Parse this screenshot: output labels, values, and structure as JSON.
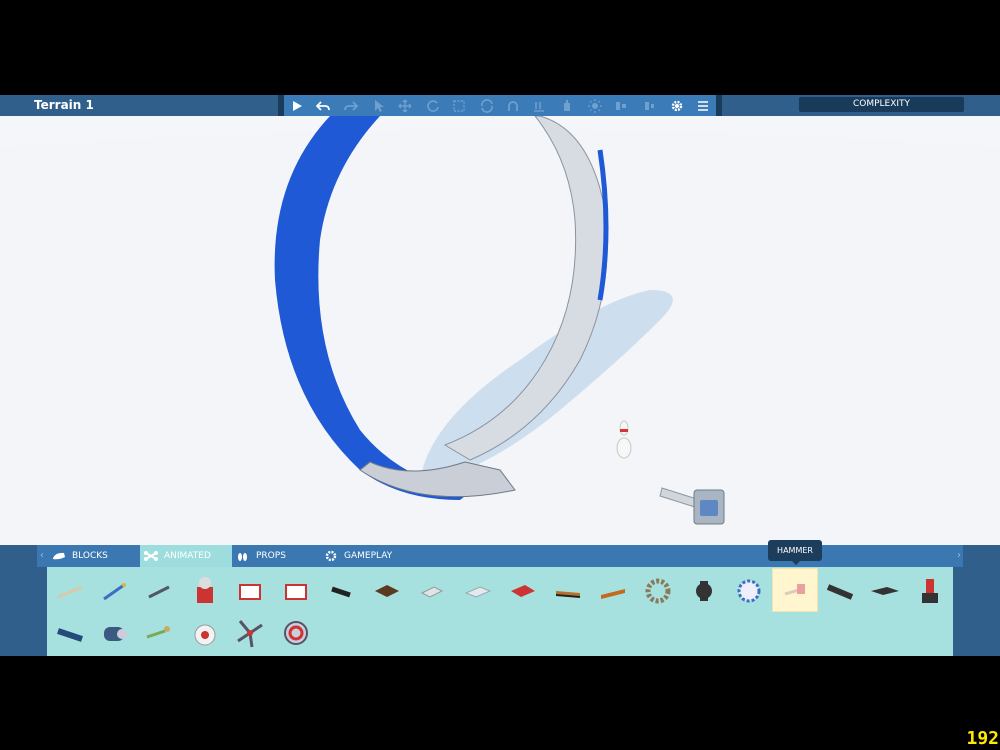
{
  "header": {
    "title": "Terrain 1",
    "complexity_label": "COMPLEXITY"
  },
  "toolbar": {
    "tools": [
      "play-icon",
      "undo-icon",
      "redo-icon",
      "select-pointer-icon",
      "move-icon",
      "rotate-icon",
      "box-select-icon",
      "refresh-icon",
      "snap-icon",
      "anchor-icon",
      "glue-icon",
      "light-icon",
      "align-icon",
      "distribute-icon",
      "gear-icon",
      "menu-icon"
    ]
  },
  "tabs": [
    {
      "label": "BLOCKS",
      "icon": "block-icon"
    },
    {
      "label": "ANIMATED",
      "icon": "bone-icon"
    },
    {
      "label": "PROPS",
      "icon": "bowling-pins-icon"
    },
    {
      "label": "GAMEPLAY",
      "icon": "gear-icon"
    }
  ],
  "tooltip": "HAMMER",
  "fps": "192",
  "colors": {
    "accent": "#3a7bb8",
    "panel": "#2f5f8a",
    "palette": "#a6e0df",
    "ring_outer": "#1f59d6",
    "ring_inner": "#e4e7ec"
  }
}
